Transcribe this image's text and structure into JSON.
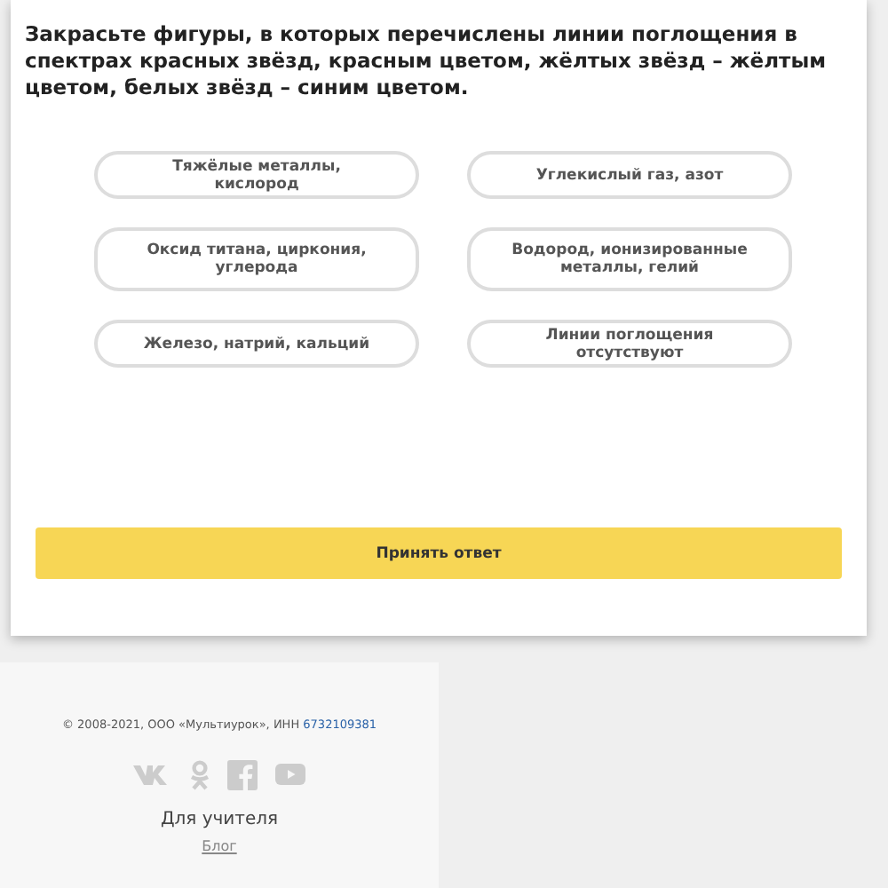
{
  "question": "Закрасьте фигуры, в которых перечислены линии поглощения в спектрах красных звёзд, красным цветом, жёлтых звёзд – жёлтым цветом, белых звёзд – синим цветом.",
  "options": [
    {
      "label": "Тяжёлые металлы, кислород",
      "selected": false
    },
    {
      "label": "Углекислый газ, азот",
      "selected": false
    },
    {
      "label": "Оксид титана, циркония, углерода",
      "selected": false
    },
    {
      "label": "Водород, ионизированные металлы, гелий",
      "selected": false
    },
    {
      "label": "Железо, натрий, кальций",
      "selected": false
    },
    {
      "label": "Линии поглощения отсутствуют",
      "selected": false
    }
  ],
  "submit_button": "Принять ответ",
  "footer": {
    "copyright": "© 2008-2021, ООО «Мультиурок», ИНН ",
    "inn": "6732109381",
    "social": [
      {
        "kind": "vk"
      },
      {
        "kind": "ok"
      },
      {
        "kind": "facebook"
      },
      {
        "kind": "youtube"
      }
    ],
    "section_title": "Для учителя",
    "links": [
      "Блог"
    ]
  }
}
